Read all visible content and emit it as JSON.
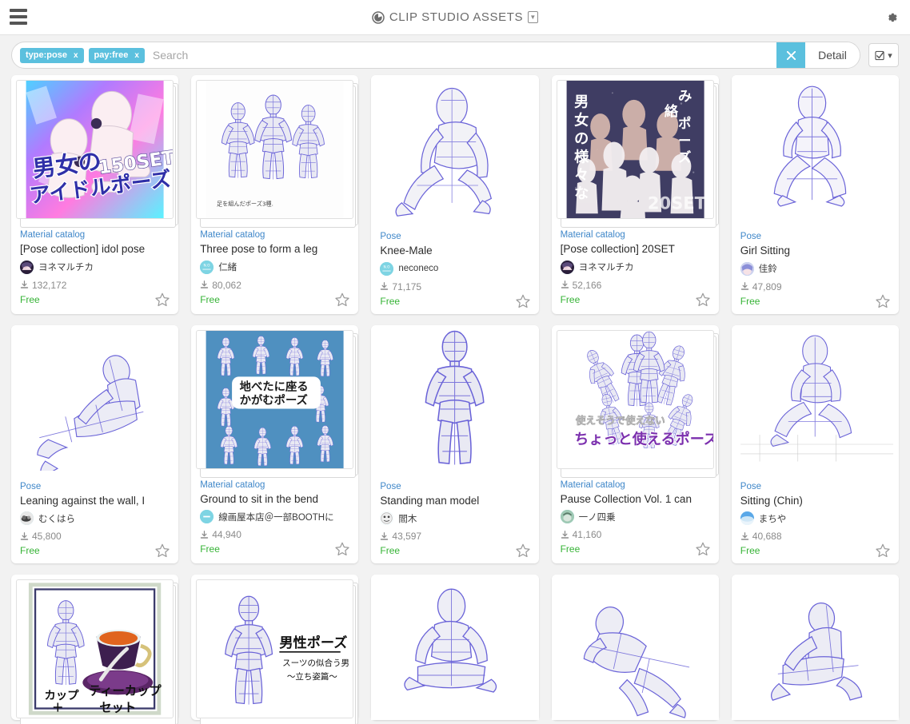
{
  "header": {
    "menu_icon": "hamburger-icon",
    "brand_title": "CLIP STUDIO ASSETS",
    "brand_badge": "▼",
    "settings_icon": "gear-icon"
  },
  "search": {
    "placeholder": "Search",
    "value": "",
    "chips": [
      {
        "label": "type:pose",
        "remove": "x"
      },
      {
        "label": "pay:free",
        "remove": "x"
      }
    ],
    "clear_label": "✖",
    "detail_label": "Detail",
    "view_menu_caret": "▾"
  },
  "colors": {
    "accent": "#5bc0de",
    "link": "#3f87c9",
    "price_free": "#36b336",
    "page_bg": "#f2f2f2"
  },
  "scroll_top": {
    "icon": "chevron-up-icon"
  },
  "cards": [
    {
      "category": "Material catalog",
      "title": "[Pose collection] idol pose",
      "author": "ヨネマルチカ",
      "downloads": "132,172",
      "price": "Free",
      "stacked": true,
      "thumb": "idol-pose-cover"
    },
    {
      "category": "Material catalog",
      "title": "Three pose to form a leg",
      "author": "仁緒",
      "downloads": "80,062",
      "price": "Free",
      "stacked": true,
      "thumb": "three-seated-figures"
    },
    {
      "category": "Pose",
      "title": "Knee-Male",
      "author": "neconeco",
      "downloads": "71,175",
      "price": "Free",
      "stacked": false,
      "thumb": "knee-male-figure"
    },
    {
      "category": "Material catalog",
      "title": "[Pose collection] 20SET",
      "author": "ヨネマルチカ",
      "downloads": "52,166",
      "price": "Free",
      "stacked": true,
      "thumb": "20set-cover"
    },
    {
      "category": "Pose",
      "title": "Girl Sitting",
      "author": "佳鈴",
      "downloads": "47,809",
      "price": "Free",
      "stacked": false,
      "thumb": "girl-sitting-figure"
    },
    {
      "category": "Pose",
      "title": "Leaning against the wall, I",
      "author": "むくはら",
      "downloads": "45,800",
      "price": "Free",
      "stacked": false,
      "thumb": "leaning-figure"
    },
    {
      "category": "Material catalog",
      "title": "Ground to sit in the bend",
      "author": "線画屋本店＠一部BOOTHに",
      "downloads": "44,940",
      "price": "Free",
      "stacked": true,
      "thumb": "ground-sit-cover"
    },
    {
      "category": "Pose",
      "title": "Standing man model",
      "author": "閻木",
      "downloads": "43,597",
      "price": "Free",
      "stacked": false,
      "thumb": "standing-man-figure"
    },
    {
      "category": "Material catalog",
      "title": "Pause Collection Vol. 1 can",
      "author": "一ノ四乗",
      "downloads": "41,160",
      "price": "Free",
      "stacked": true,
      "thumb": "pause-collection-cover"
    },
    {
      "category": "Pose",
      "title": "Sitting (Chin)",
      "author": "まちや",
      "downloads": "40,688",
      "price": "Free",
      "stacked": false,
      "thumb": "sitting-chin-figure"
    },
    {
      "category": "",
      "title": "",
      "author": "",
      "downloads": "",
      "price": "",
      "stacked": true,
      "thumb": "teacup-pose-cover"
    },
    {
      "category": "",
      "title": "",
      "author": "",
      "downloads": "",
      "price": "",
      "stacked": true,
      "thumb": "male-pose-suit-cover"
    },
    {
      "category": "",
      "title": "",
      "author": "",
      "downloads": "",
      "price": "",
      "stacked": false,
      "thumb": "sitting-cross-legged-figure"
    },
    {
      "category": "",
      "title": "",
      "author": "",
      "downloads": "",
      "price": "",
      "stacked": false,
      "thumb": "crouch-forward-figure"
    },
    {
      "category": "",
      "title": "",
      "author": "",
      "downloads": "",
      "price": "",
      "stacked": false,
      "thumb": "kneel-lean-figure"
    }
  ]
}
